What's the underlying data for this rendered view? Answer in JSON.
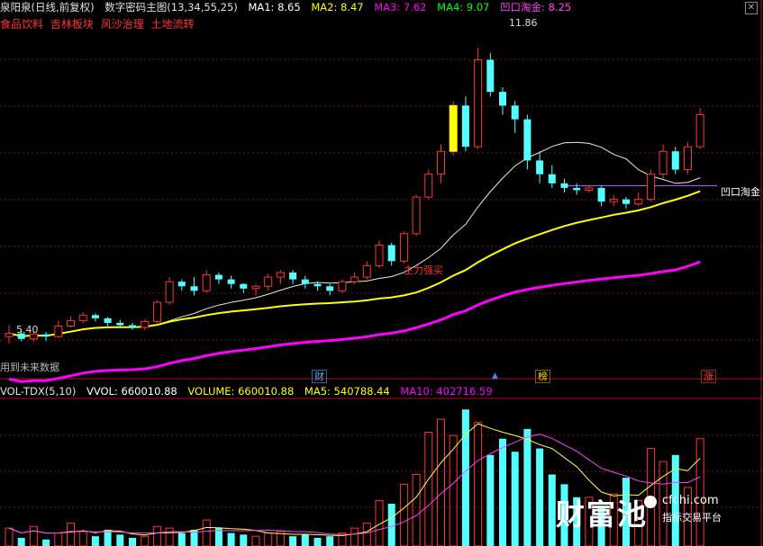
{
  "header": {
    "stock_name": "泉阳泉(日线,前复权)",
    "indicator_name": "数字密码主图(13,34,55,25)",
    "ma1": "MA1: 8.65",
    "ma2": "MA2: 8.47",
    "ma3": "MA3: 7.62",
    "ma4": "MA4: 9.07",
    "aokou": "凹口淘金: 8.25"
  },
  "concepts": [
    "食品饮料",
    "吉林板块",
    "风沙治理",
    "土地流转"
  ],
  "annotations": {
    "high_price": "11.86",
    "low_price": "5.40",
    "aokou_label": "凹口淘金",
    "main_force_label": "主力强买",
    "future_data": "用到未来数据"
  },
  "markers": {
    "cai": "财",
    "bang": "榜",
    "zhang": "涨",
    "up_arrow": "▲"
  },
  "volume_header": {
    "name": "VOL-TDX(5,10)",
    "vvol": "VVOL: 660010.88",
    "volume": "VOLUME: 660010.88",
    "ma5": "MA5: 540788.44",
    "ma10": "MA10: 402716.59"
  },
  "watermark": {
    "brand": "财富池",
    "site": "cfchi.com",
    "slogan": "指标交易平台"
  },
  "colors": {
    "up": "#ff3232",
    "down": "#54ffff",
    "ma_white": "#e8e8e8",
    "ma_yellow": "#ffff00",
    "ma_magenta": "#ff00ff",
    "aokou_line": "#c060ff",
    "grid": "#7a1010"
  },
  "chart_data": [
    {
      "type": "candlestick",
      "title": "泉阳泉(日线,前复权)",
      "y_range": [
        5.2,
        12.2
      ],
      "annotations": {
        "max": 11.86,
        "min": 5.4
      },
      "candles": [
        [
          5.55,
          5.62,
          5.4,
          5.8
        ],
        [
          5.62,
          5.5,
          5.45,
          5.7
        ],
        [
          5.5,
          5.6,
          5.45,
          5.65
        ],
        [
          5.6,
          5.55,
          5.45,
          5.65
        ],
        [
          5.55,
          5.78,
          5.52,
          5.9
        ],
        [
          5.78,
          5.9,
          5.75,
          6.0
        ],
        [
          5.9,
          6.02,
          5.85,
          6.08
        ],
        [
          6.02,
          5.95,
          5.88,
          6.06
        ],
        [
          5.95,
          5.85,
          5.78,
          5.98
        ],
        [
          5.85,
          5.8,
          5.75,
          5.92
        ],
        [
          5.8,
          5.75,
          5.7,
          5.85
        ],
        [
          5.75,
          5.88,
          5.7,
          5.92
        ],
        [
          5.88,
          6.3,
          5.85,
          6.35
        ],
        [
          6.3,
          6.75,
          6.25,
          6.85
        ],
        [
          6.75,
          6.65,
          6.55,
          6.8
        ],
        [
          6.65,
          6.55,
          6.45,
          6.85
        ],
        [
          6.55,
          6.9,
          6.5,
          7.0
        ],
        [
          6.9,
          6.8,
          6.7,
          6.95
        ],
        [
          6.8,
          6.7,
          6.6,
          6.88
        ],
        [
          6.7,
          6.6,
          6.5,
          6.72
        ],
        [
          6.6,
          6.65,
          6.45,
          6.7
        ],
        [
          6.65,
          6.85,
          6.55,
          6.92
        ],
        [
          6.85,
          6.95,
          6.7,
          7.0
        ],
        [
          6.95,
          6.8,
          6.7,
          7.0
        ],
        [
          6.8,
          6.7,
          6.6,
          6.88
        ],
        [
          6.7,
          6.65,
          6.55,
          6.75
        ],
        [
          6.65,
          6.55,
          6.45,
          6.7
        ],
        [
          6.55,
          6.75,
          6.5,
          6.8
        ],
        [
          6.75,
          6.85,
          6.7,
          6.95
        ],
        [
          6.85,
          7.1,
          6.8,
          7.2
        ],
        [
          7.1,
          7.55,
          7.05,
          7.65
        ],
        [
          7.55,
          7.2,
          7.1,
          7.6
        ],
        [
          7.2,
          7.8,
          7.15,
          7.85
        ],
        [
          7.8,
          8.6,
          7.75,
          8.65
        ],
        [
          8.6,
          9.1,
          8.55,
          9.2
        ],
        [
          9.1,
          9.6,
          8.9,
          9.75
        ],
        [
          9.6,
          10.6,
          9.5,
          10.7
        ],
        [
          10.6,
          9.7,
          9.6,
          10.8
        ],
        [
          9.7,
          11.6,
          9.65,
          11.86
        ],
        [
          11.6,
          10.9,
          10.8,
          11.75
        ],
        [
          10.9,
          10.6,
          10.4,
          11.0
        ],
        [
          10.6,
          10.3,
          10.0,
          10.7
        ],
        [
          10.3,
          9.4,
          9.2,
          10.4
        ],
        [
          9.4,
          9.1,
          8.9,
          9.6
        ],
        [
          9.1,
          8.9,
          8.8,
          9.3
        ],
        [
          8.9,
          8.8,
          8.7,
          9.0
        ],
        [
          8.8,
          8.75,
          8.65,
          8.9
        ],
        [
          8.75,
          8.8,
          8.7,
          8.85
        ],
        [
          8.8,
          8.5,
          8.4,
          8.85
        ],
        [
          8.5,
          8.55,
          8.4,
          8.65
        ],
        [
          8.55,
          8.45,
          8.35,
          8.6
        ],
        [
          8.45,
          8.55,
          8.4,
          8.7
        ],
        [
          8.55,
          9.1,
          8.5,
          9.2
        ],
        [
          9.1,
          9.6,
          9.0,
          9.75
        ],
        [
          9.6,
          9.2,
          9.1,
          9.7
        ],
        [
          9.2,
          9.7,
          9.1,
          9.8
        ],
        [
          9.7,
          10.4,
          9.65,
          10.55
        ]
      ]
    },
    {
      "type": "bar",
      "title": "VOL-TDX(5,10)",
      "values": [
        0.55,
        0.25,
        0.6,
        0.2,
        0.4,
        0.7,
        0.45,
        0.3,
        0.5,
        0.35,
        0.25,
        0.3,
        0.6,
        0.55,
        0.4,
        0.5,
        0.8,
        0.55,
        0.4,
        0.35,
        0.3,
        0.4,
        0.45,
        0.3,
        0.35,
        0.25,
        0.3,
        0.4,
        0.55,
        0.7,
        1.4,
        1.3,
        1.9,
        2.2,
        3.5,
        3.9,
        3.4,
        4.2,
        3.8,
        2.8,
        3.3,
        2.9,
        3.6,
        3.0,
        2.2,
        1.9,
        1.5,
        1.5,
        1.2,
        1.6,
        2.1,
        1.4,
        3.0,
        2.6,
        2.8,
        1.8,
        3.3
      ],
      "up": [
        true,
        false,
        true,
        false,
        true,
        true,
        true,
        false,
        false,
        false,
        false,
        true,
        true,
        true,
        false,
        false,
        true,
        false,
        false,
        false,
        true,
        true,
        true,
        false,
        false,
        false,
        false,
        true,
        true,
        true,
        true,
        false,
        true,
        true,
        true,
        true,
        true,
        false,
        true,
        false,
        false,
        false,
        false,
        false,
        false,
        false,
        false,
        true,
        false,
        true,
        false,
        true,
        true,
        true,
        false,
        true,
        true
      ]
    }
  ]
}
